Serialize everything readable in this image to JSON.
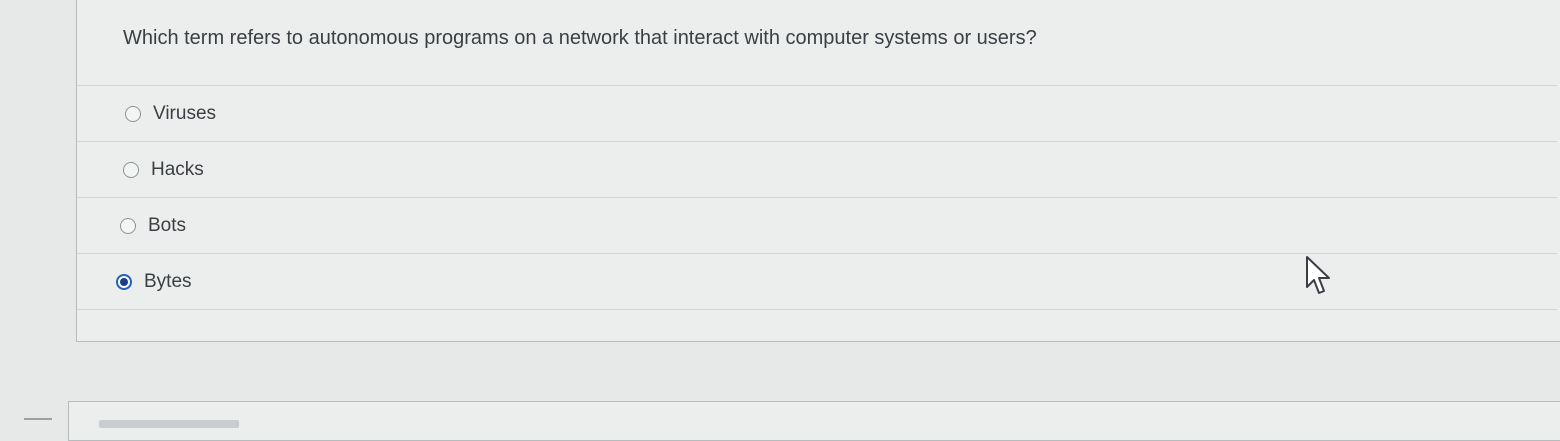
{
  "question": {
    "text": "Which term refers to autonomous programs on a network that interact with computer systems or users?",
    "options": [
      {
        "label": "Viruses",
        "selected": false
      },
      {
        "label": "Hacks",
        "selected": false
      },
      {
        "label": "Bots",
        "selected": false
      },
      {
        "label": "Bytes",
        "selected": true
      }
    ]
  },
  "colors": {
    "accent": "#1f5fbf",
    "selected_dot": "#1a3d8a",
    "background": "#e6e9e8"
  },
  "icons": {
    "cursor": "mouse-pointer-icon",
    "radio": "radio-button-icon"
  }
}
